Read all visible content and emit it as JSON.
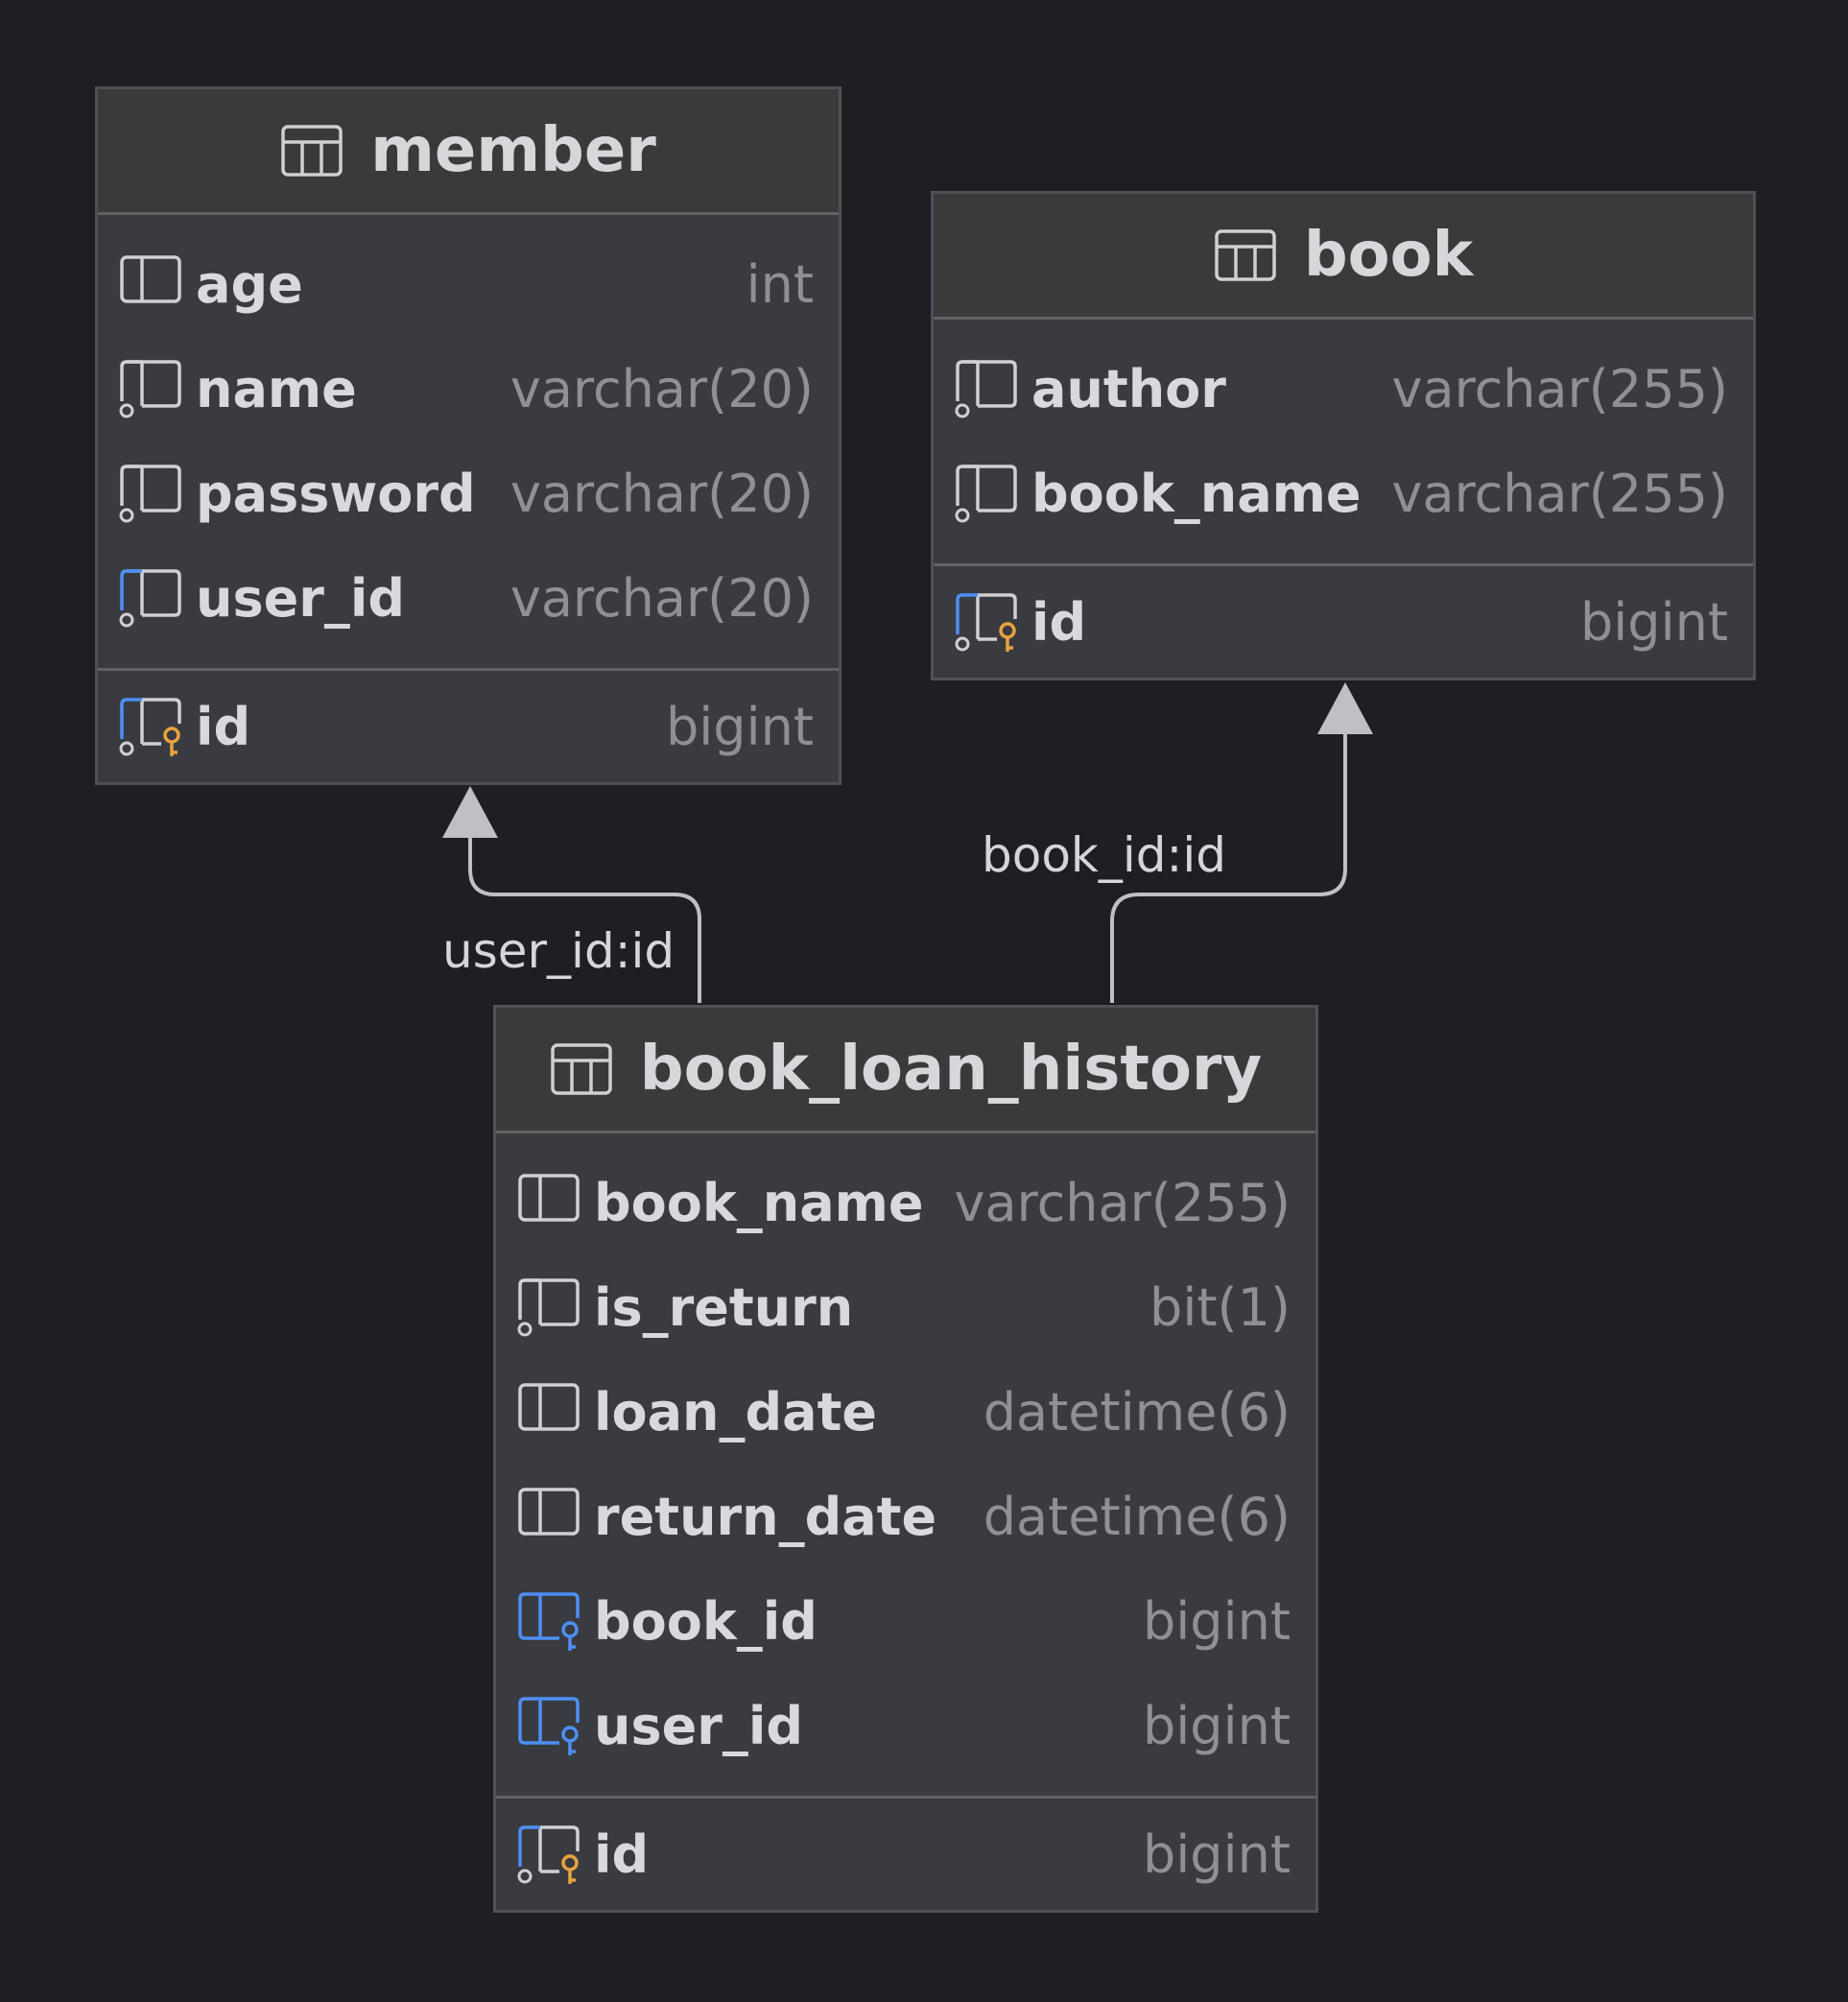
{
  "tables": {
    "member": {
      "title": "member",
      "columns": [
        {
          "name": "age",
          "type": "int",
          "icon": "column-icon"
        },
        {
          "name": "name",
          "type": "varchar(20)",
          "icon": "column-not-null-icon"
        },
        {
          "name": "password",
          "type": "varchar(20)",
          "icon": "column-not-null-icon"
        },
        {
          "name": "user_id",
          "type": "varchar(20)",
          "icon": "column-unique-index-icon"
        }
      ],
      "keys": [
        {
          "name": "id",
          "type": "bigint",
          "icon": "primary-key-icon"
        }
      ]
    },
    "book": {
      "title": "book",
      "columns": [
        {
          "name": "author",
          "type": "varchar(255)",
          "icon": "column-not-null-icon"
        },
        {
          "name": "book_name",
          "type": "varchar(255)",
          "icon": "column-not-null-icon"
        }
      ],
      "keys": [
        {
          "name": "id",
          "type": "bigint",
          "icon": "primary-key-icon"
        }
      ]
    },
    "book_loan_history": {
      "title": "book_loan_history",
      "columns": [
        {
          "name": "book_name",
          "type": "varchar(255)",
          "icon": "column-icon"
        },
        {
          "name": "is_return",
          "type": "bit(1)",
          "icon": "column-not-null-icon"
        },
        {
          "name": "loan_date",
          "type": "datetime(6)",
          "icon": "column-icon"
        },
        {
          "name": "return_date",
          "type": "datetime(6)",
          "icon": "column-icon"
        },
        {
          "name": "book_id",
          "type": "bigint",
          "icon": "foreign-key-icon"
        },
        {
          "name": "user_id",
          "type": "bigint",
          "icon": "foreign-key-icon"
        }
      ],
      "keys": [
        {
          "name": "id",
          "type": "bigint",
          "icon": "primary-key-icon"
        }
      ]
    }
  },
  "relations": {
    "user_id": {
      "label": "user_id:id"
    },
    "book_id": {
      "label": "book_id:id"
    }
  },
  "colors": {
    "background": "#1e1f22",
    "table_body": "#393b40",
    "key_gold": "#e8a33d",
    "index_blue": "#4e8ff5",
    "connector": "#bfc0c3"
  }
}
